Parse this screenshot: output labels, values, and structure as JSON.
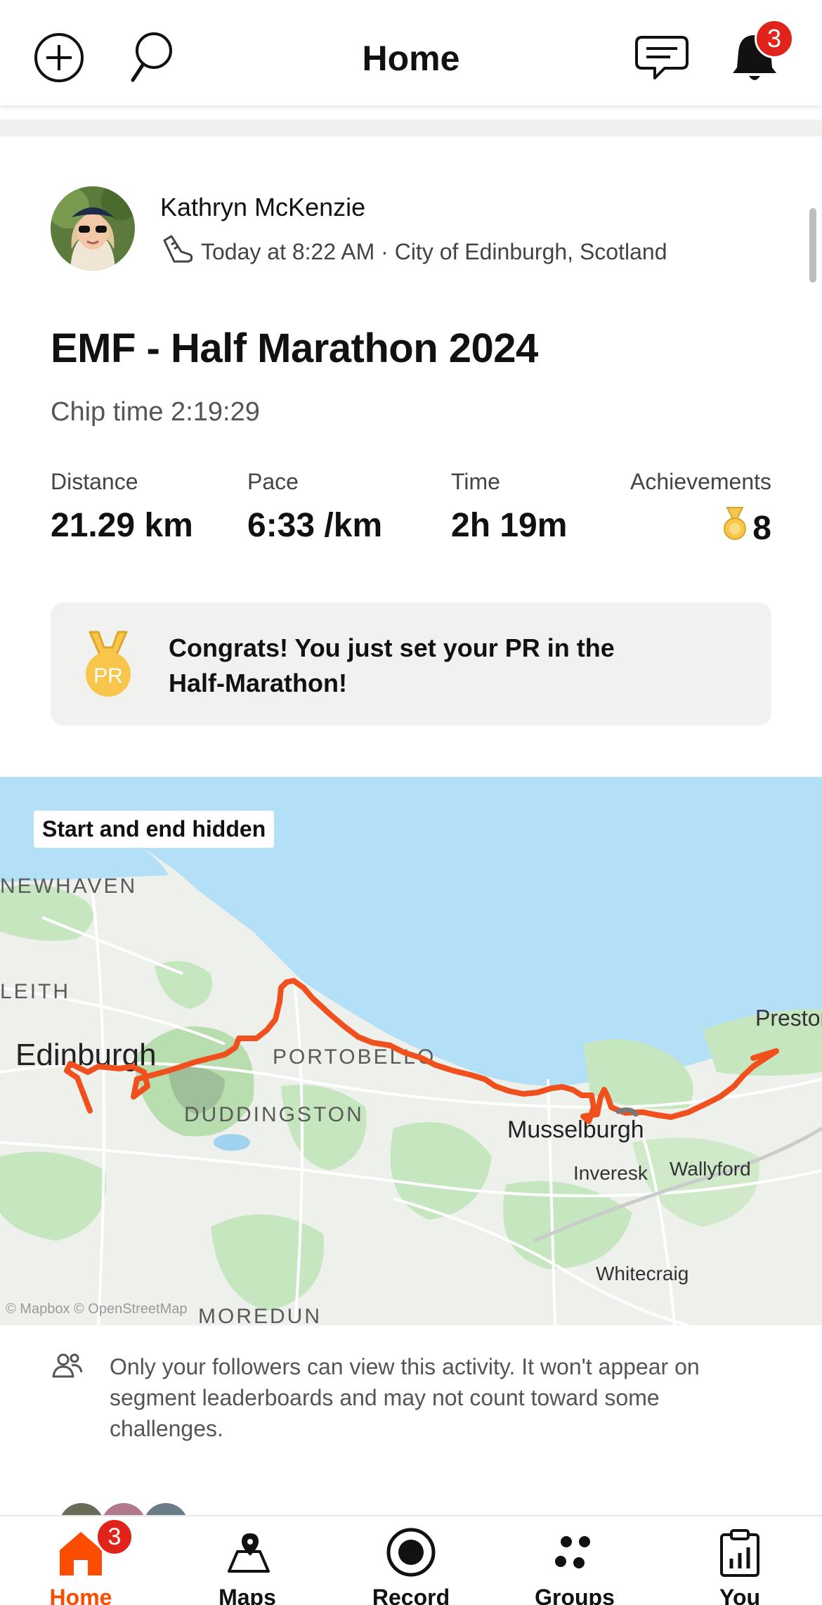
{
  "header": {
    "title": "Home",
    "notification_count": "3"
  },
  "activity": {
    "athlete_name": "Kathryn McKenzie",
    "meta": "Today at 8:22 AM · City of Edinburgh, Scotland",
    "title": "EMF - Half Marathon 2024",
    "description": "Chip time 2:19:29",
    "stats": [
      {
        "label": "Distance",
        "value": "21.29 km"
      },
      {
        "label": "Pace",
        "value": "6:33 /km"
      },
      {
        "label": "Time",
        "value": "2h 19m"
      },
      {
        "label": "Achievements",
        "value": "8"
      }
    ],
    "pr_message": "Congrats! You just set your PR in the Half-Marathon!",
    "pr_badge": "PR"
  },
  "map": {
    "hidden_label": "Start and end hidden",
    "attribution": "© Mapbox © OpenStreetMap",
    "place_labels": [
      "NEWHAVEN",
      "LEITH",
      "Edinburgh",
      "PORTOBELLO",
      "DUDDINGSTON",
      "Musselburgh",
      "Inveresk",
      "Wallyford",
      "Prestonpans",
      "Whitecraig",
      "MOREDUN"
    ],
    "route_color": "#f0501e",
    "water_color": "#b3e0f7"
  },
  "privacy_notice": "Only your followers can view this activity. It won't appear on segment leaderboards and may not count toward some challenges.",
  "bottom_nav": {
    "items": [
      {
        "label": "Home",
        "active": true
      },
      {
        "label": "Maps"
      },
      {
        "label": "Record"
      },
      {
        "label": "Groups"
      },
      {
        "label": "You"
      }
    ],
    "home_badge": "3"
  },
  "colors": {
    "accent": "#fc4c02",
    "badge": "#e0241b",
    "medal": "#f7c64a"
  }
}
